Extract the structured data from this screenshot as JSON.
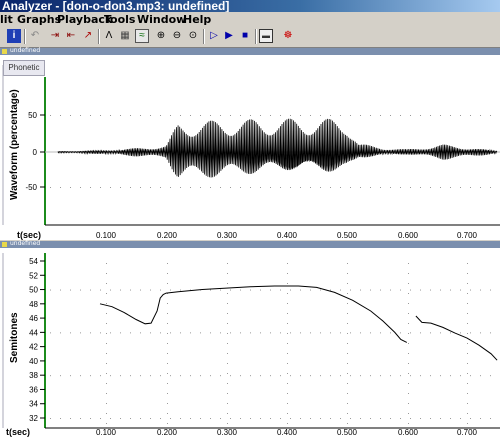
{
  "window": {
    "title": "Analyzer - [don-o-don3.mp3: undefined]"
  },
  "menu": {
    "items": [
      "lit",
      "Graphs",
      "Playback",
      "Tools",
      "Window",
      "Help"
    ]
  },
  "toolbar": {
    "icons": [
      "info-icon",
      "undo-icon",
      "step-icon",
      "step2-icon",
      "wave-icon",
      "grid-icon",
      "lines-icon",
      "edit-icon",
      "zoom-in-icon",
      "zoom-out-icon",
      "zoom-fit-icon",
      "play-from-icon",
      "play-icon",
      "stop-icon",
      "record-icon",
      "spectro-icon"
    ]
  },
  "panes": [
    {
      "caption": "undefined",
      "tab": "Phonetic",
      "ylabel": "Waveform (percentage)",
      "xlabel": "t(sec)",
      "yticks": [
        "50",
        "0",
        "-50"
      ],
      "xticks": [
        "0.100",
        "0.200",
        "0.300",
        "0.400",
        "0.500",
        "0.600",
        "0.700"
      ]
    },
    {
      "caption": "undefined",
      "ylabel": "Semitones",
      "xlabel": "t(sec)",
      "yticks": [
        "54",
        "52",
        "50",
        "48",
        "46",
        "44",
        "42",
        "40",
        "38",
        "36",
        "34",
        "32"
      ],
      "xticks": [
        "0.100",
        "0.200",
        "0.300",
        "0.400",
        "0.500",
        "0.600",
        "0.700"
      ]
    }
  ],
  "chart_data": [
    {
      "type": "line",
      "ylabel": "Waveform (percentage)",
      "xlabel": "t(sec)",
      "xlim": [
        0.0,
        0.75
      ],
      "ylim": [
        -80,
        80
      ],
      "series": [
        {
          "segments": [
            {
              "x": [
                0.02,
                0.1,
                0.2,
                0.22,
                0.3,
                0.4,
                0.5,
                0.52,
                0.56,
                0.6,
                0.62,
                0.66,
                0.7,
                0.75
              ],
              "amp": [
                1,
                3,
                10,
                45,
                45,
                45,
                45,
                12,
                6,
                4,
                6,
                12,
                8,
                2
              ]
            }
          ]
        }
      ],
      "grid": true
    },
    {
      "type": "line",
      "ylabel": "Semitones",
      "xlabel": "t(sec)",
      "xlim": [
        0.0,
        0.75
      ],
      "ylim": [
        31,
        55
      ],
      "series": [
        {
          "segments": [
            {
              "x": [
                0.09,
                0.11,
                0.13,
                0.15,
                0.165,
                0.175,
                0.185,
                0.19,
                0.195,
                0.2,
                0.22,
                0.26,
                0.3,
                0.34,
                0.38,
                0.42,
                0.45,
                0.48,
                0.51,
                0.54,
                0.56,
                0.58,
                0.59,
                0.6
              ],
              "y": [
                48.0,
                47.6,
                46.8,
                45.8,
                45.2,
                45.3,
                47.0,
                48.8,
                49.3,
                49.5,
                49.7,
                50.0,
                50.2,
                50.4,
                50.5,
                50.5,
                50.3,
                49.6,
                48.5,
                47.0,
                45.6,
                44.0,
                43.0,
                42.6
              ]
            },
            {
              "x": [
                0.615,
                0.625,
                0.64,
                0.66,
                0.68,
                0.7,
                0.72,
                0.74,
                0.75
              ],
              "y": [
                46.3,
                45.4,
                45.3,
                44.7,
                43.9,
                43.2,
                42.2,
                41.0,
                40.1
              ]
            }
          ]
        }
      ],
      "grid": true
    }
  ],
  "colors": {
    "axis": "#1c8c1c",
    "curve": "#000000",
    "grid": "#9a9a9a",
    "titlebar": "#0a246a"
  }
}
